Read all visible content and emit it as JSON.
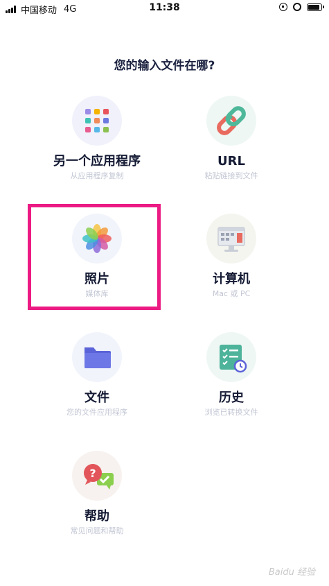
{
  "status_bar": {
    "carrier": "中国移动",
    "network": "4G",
    "time": "11:38",
    "icons": [
      "signal-icon",
      "orientation-lock-icon",
      "alarm-icon",
      "battery-icon"
    ],
    "battery_level": 0.9
  },
  "heading": "您的输入文件在哪?",
  "options": [
    {
      "id": "another-app",
      "title": "另一个应用程序",
      "subtitle": "从应用程序复制",
      "icon": "app-grid-icon"
    },
    {
      "id": "url",
      "title": "URL",
      "subtitle": "粘贴链接到文件",
      "icon": "link-icon"
    },
    {
      "id": "photos",
      "title": "照片",
      "subtitle": "媒体库",
      "icon": "photos-icon"
    },
    {
      "id": "computer",
      "title": "计算机",
      "subtitle": "Mac 或 PC",
      "icon": "computer-icon"
    },
    {
      "id": "files",
      "title": "文件",
      "subtitle": "您的文件应用程序",
      "icon": "folder-icon"
    },
    {
      "id": "history",
      "title": "历史",
      "subtitle": "浏览已转换文件",
      "icon": "history-icon"
    },
    {
      "id": "help",
      "title": "帮助",
      "subtitle": "常见问题和帮助",
      "icon": "help-icon"
    }
  ],
  "highlighted_option": "photos",
  "colors": {
    "heading": "#1c2340",
    "subtitle": "#c3c7d4",
    "highlight_border": "#ec1a83",
    "circle_bg": "#f1f4fb"
  },
  "watermark": "Baidu 经验"
}
